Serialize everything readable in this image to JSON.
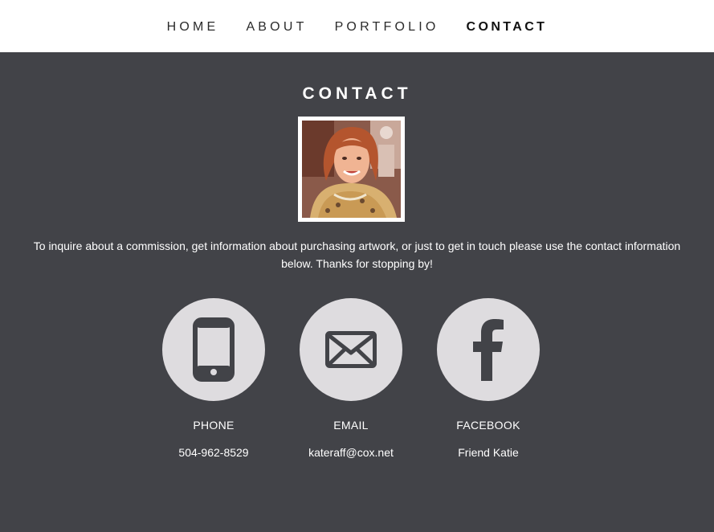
{
  "nav": {
    "items": [
      {
        "label": "HOME"
      },
      {
        "label": "ABOUT"
      },
      {
        "label": "PORTFOLIO"
      },
      {
        "label": "CONTACT",
        "active": true
      }
    ]
  },
  "page": {
    "title": "CONTACT",
    "intro": "To inquire about a commission, get information about purchasing artwork, or just to get in touch please use the contact information below. Thanks for stopping by!"
  },
  "contacts": [
    {
      "icon": "phone-icon",
      "label": "PHONE",
      "value": "504-962-8529"
    },
    {
      "icon": "envelope-icon",
      "label": "EMAIL",
      "value": "kateraff@cox.net"
    },
    {
      "icon": "facebook-icon",
      "label": "FACEBOOK",
      "value": "Friend Katie"
    }
  ],
  "colors": {
    "background": "#424348",
    "header": "#ffffff",
    "circle": "#dedcdf",
    "icon": "#424348"
  }
}
